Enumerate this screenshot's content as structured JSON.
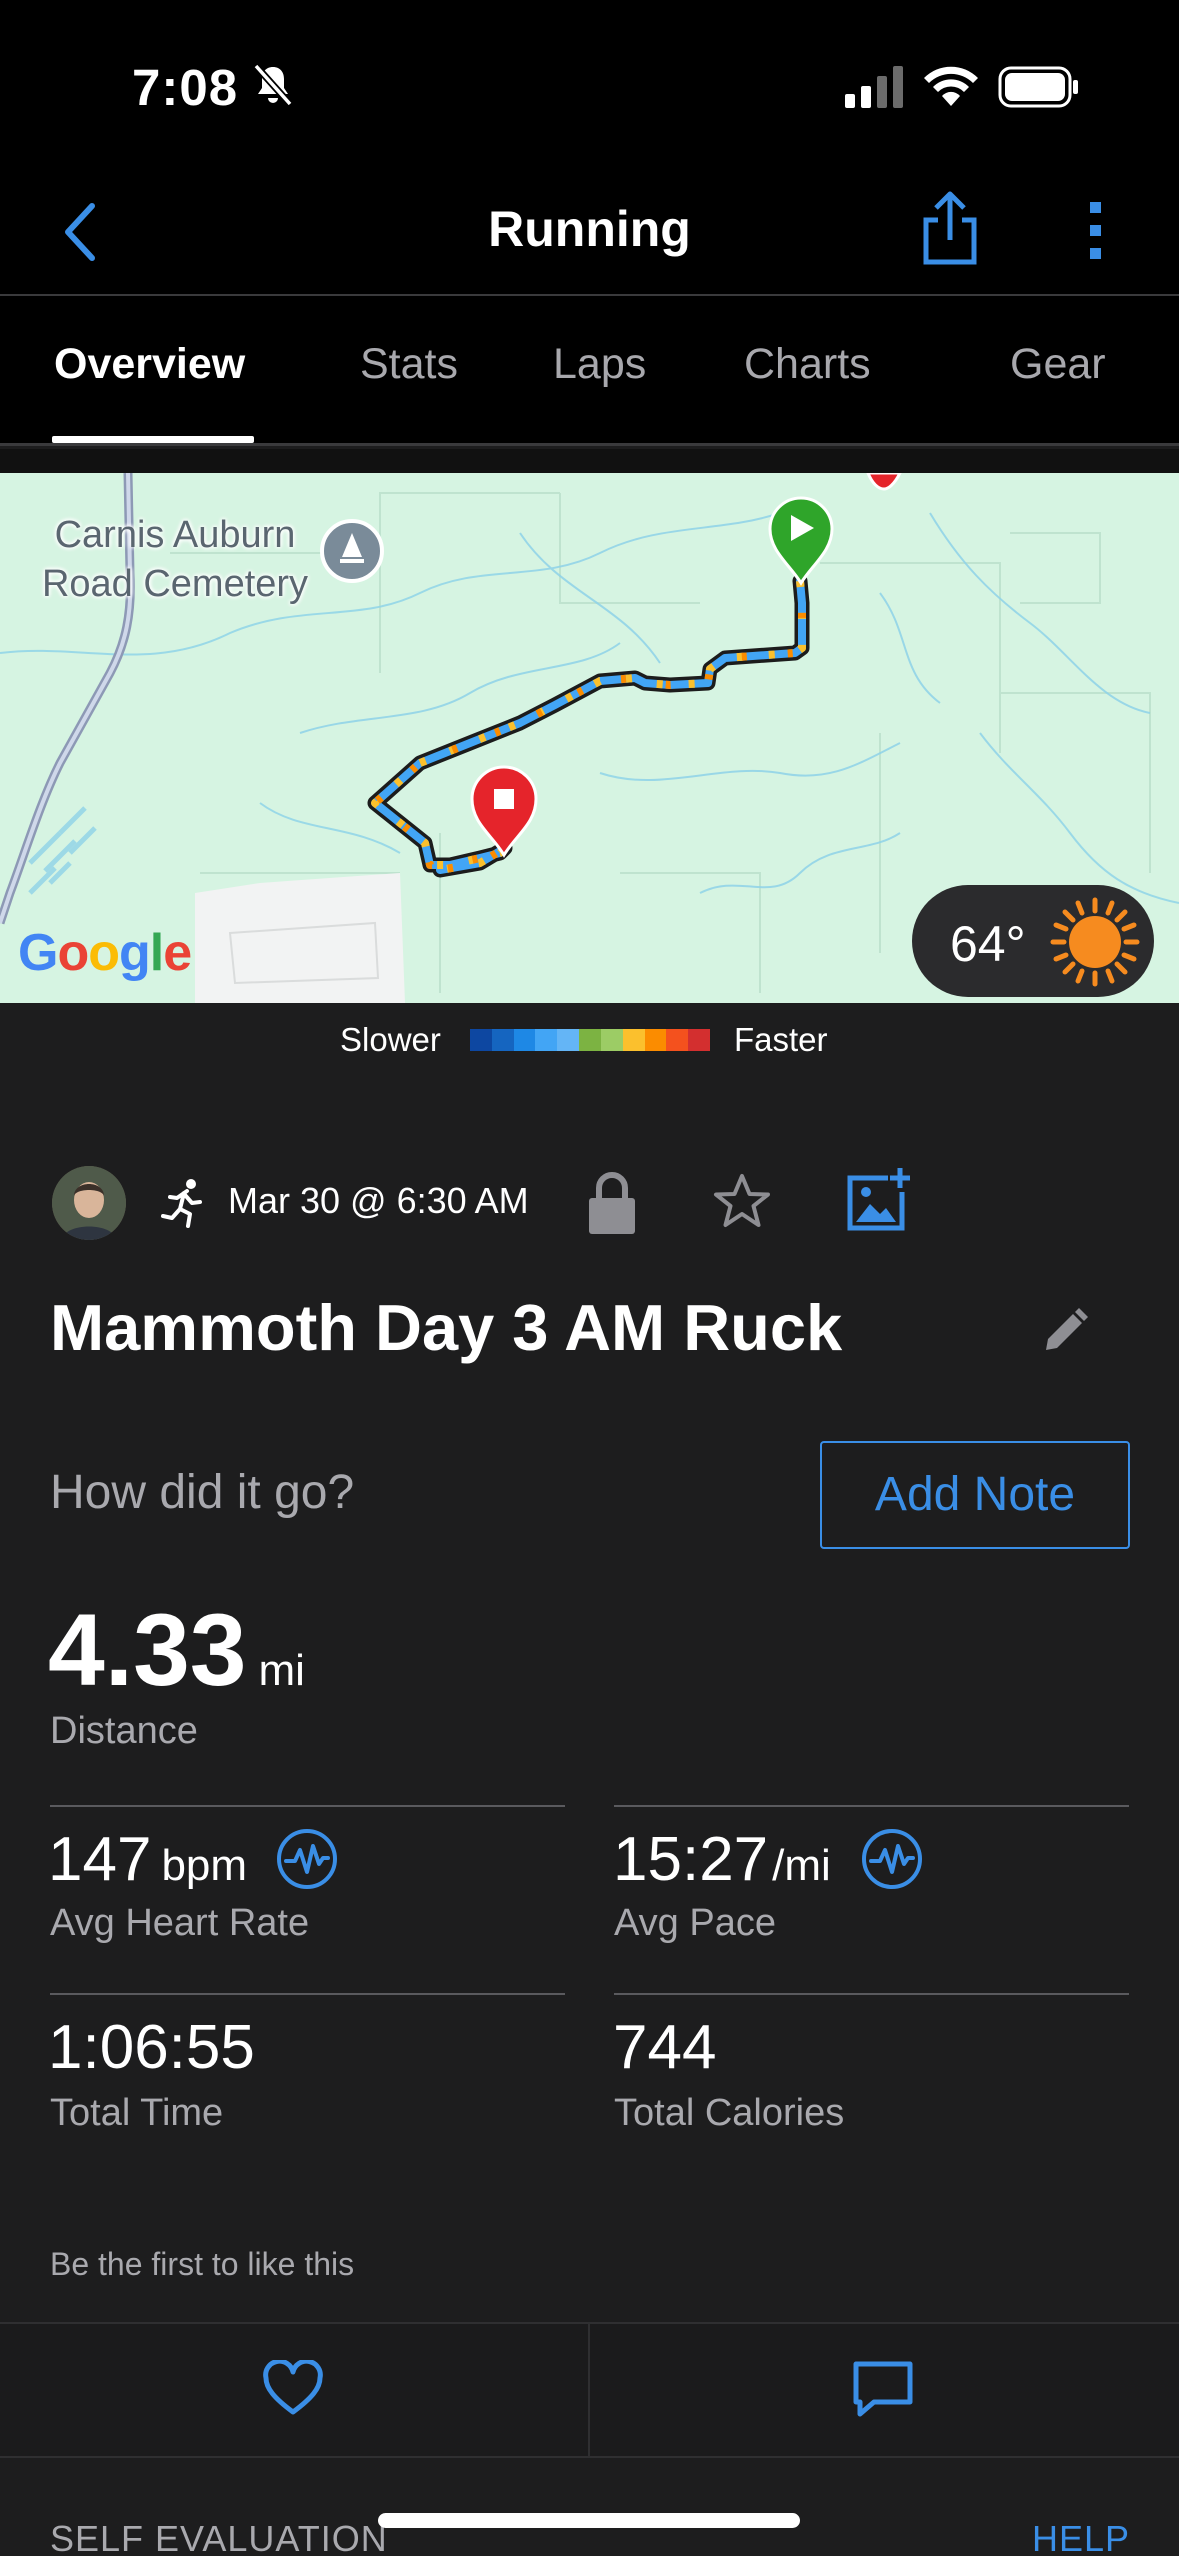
{
  "status_bar": {
    "time": "7:08",
    "icons": [
      "bell-slash-icon",
      "cell-signal-icon",
      "wifi-icon",
      "battery-icon"
    ]
  },
  "nav": {
    "title": "Running",
    "icons": [
      "back-chevron-icon",
      "share-icon",
      "more-vertical-icon"
    ]
  },
  "tabs": [
    {
      "label": "Overview",
      "active": true
    },
    {
      "label": "Stats",
      "active": false
    },
    {
      "label": "Laps",
      "active": false
    },
    {
      "label": "Charts",
      "active": false
    },
    {
      "label": "Gear",
      "active": false
    }
  ],
  "map": {
    "poi_label_line1": "Carnis Auburn",
    "poi_label_line2": "Road Cemetery",
    "google_logo": "Google",
    "weather_temp": "64°"
  },
  "legend": {
    "slower": "Slower",
    "faster": "Faster",
    "colors": [
      "#0d47a1",
      "#1565c0",
      "#1e88e5",
      "#42a5f5",
      "#64b5f6",
      "#7cb342",
      "#9ccc65",
      "#fbc02d",
      "#fb8c00",
      "#f4511e",
      "#d32f2f"
    ]
  },
  "activity": {
    "date": "Mar 30 @ 6:30 AM",
    "title": "Mammoth Day 3 AM Ruck",
    "prompt": "How did it go?",
    "add_note": "Add Note"
  },
  "stats": {
    "distance": {
      "value": "4.33",
      "unit": "mi",
      "label": "Distance"
    },
    "heart_rate": {
      "value": "147",
      "unit": "bpm",
      "label": "Avg Heart Rate"
    },
    "pace": {
      "value": "15:27",
      "unit": "/mi",
      "label": "Avg Pace"
    },
    "time": {
      "value": "1:06:55",
      "label": "Total Time"
    },
    "calories": {
      "value": "744",
      "label": "Total Calories"
    }
  },
  "social": {
    "first_like": "Be the first to like this"
  },
  "footer": {
    "self_evaluation": "SELF EVALUATION",
    "help": "HELP"
  },
  "colors": {
    "accent": "#3a8ee6",
    "background": "#1d1d1e",
    "bar": "#000000"
  }
}
